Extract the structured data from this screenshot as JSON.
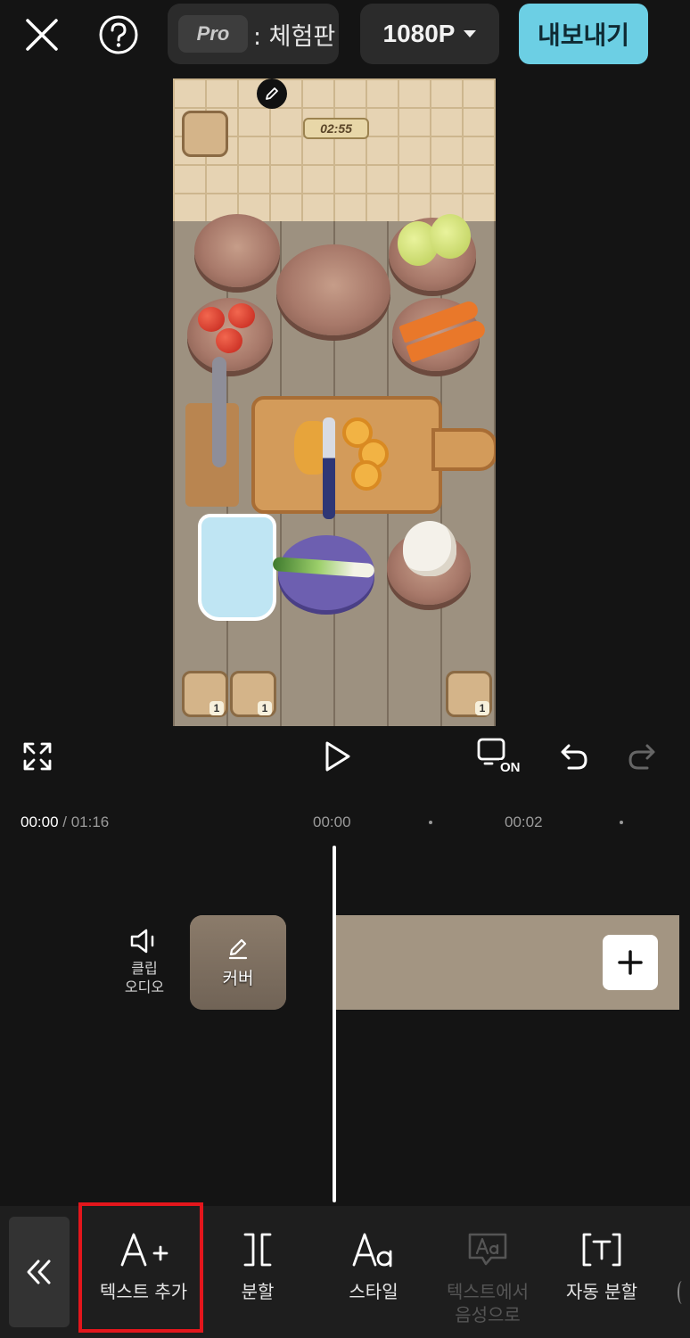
{
  "top_bar": {
    "pro_badge": "Pro",
    "pro_label": ": 체험판",
    "resolution": "1080P",
    "export_label": "내보내기"
  },
  "preview": {
    "timer": "02:55",
    "powerup_counts": [
      "1",
      "1",
      "1"
    ]
  },
  "playback": {
    "current_time": "00:00",
    "separator": " / ",
    "total_time": "01:16",
    "ruler_marks": [
      "00:00",
      "00:02"
    ],
    "preview_toggle_badge": "ON"
  },
  "timeline": {
    "clip_audio_line1": "클립",
    "clip_audio_line2": "오디오",
    "cover_label": "커버"
  },
  "toolbar": {
    "items": [
      {
        "label": "텍스트 추가",
        "glyph": "A+"
      },
      {
        "label": "분할",
        "glyph": "]["
      },
      {
        "label": "스타일",
        "glyph": "Aa"
      },
      {
        "label": "텍스트에서 음성으로",
        "glyph": "Aa",
        "disabled": true
      },
      {
        "label": "자동 분할",
        "glyph": "[T]"
      }
    ]
  },
  "colors": {
    "accent": "#6ccfe4",
    "highlight": "#e3161c",
    "background": "#141414"
  }
}
